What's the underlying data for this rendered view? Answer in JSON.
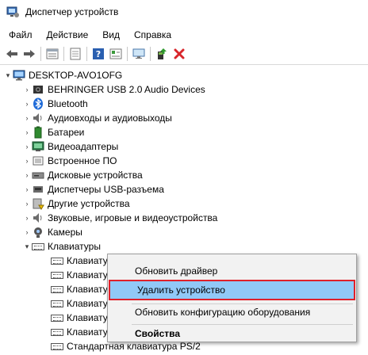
{
  "window": {
    "title": "Диспетчер устройств"
  },
  "menu": [
    "Файл",
    "Действие",
    "Вид",
    "Справка"
  ],
  "toolbar": [
    "back-icon",
    "forward-icon",
    "properties-icon",
    "show-hidden-icon",
    "help-icon",
    "view-icon",
    "scan-hardware-icon",
    "update-driver-icon",
    "uninstall-icon"
  ],
  "tree": {
    "root": "DESKTOP-AVO1OFG",
    "categories": [
      "BEHRINGER USB 2.0 Audio Devices",
      "Bluetooth",
      "Аудиовходы и аудиовыходы",
      "Батареи",
      "Видеоадаптеры",
      "Встроенное ПО",
      "Дисковые устройства",
      "Диспетчеры USB-разъема",
      "Другие устройства",
      "Звуковые, игровые и видеоустройства",
      "Камеры",
      "Клавиатуры"
    ],
    "keyboards": [
      "Клавиатура HID",
      "Клавиату",
      "Клавиату",
      "Клавиату",
      "Клавиату",
      "Клавиату",
      "Стандартная клавиатура PS/2"
    ]
  },
  "context_menu": {
    "update_driver": "Обновить драйвер",
    "uninstall": "Удалить устройство",
    "scan": "Обновить конфигурацию оборудования",
    "properties": "Свойства"
  },
  "colors": {
    "highlight": "#91c9f7",
    "outline": "#e0202a"
  }
}
